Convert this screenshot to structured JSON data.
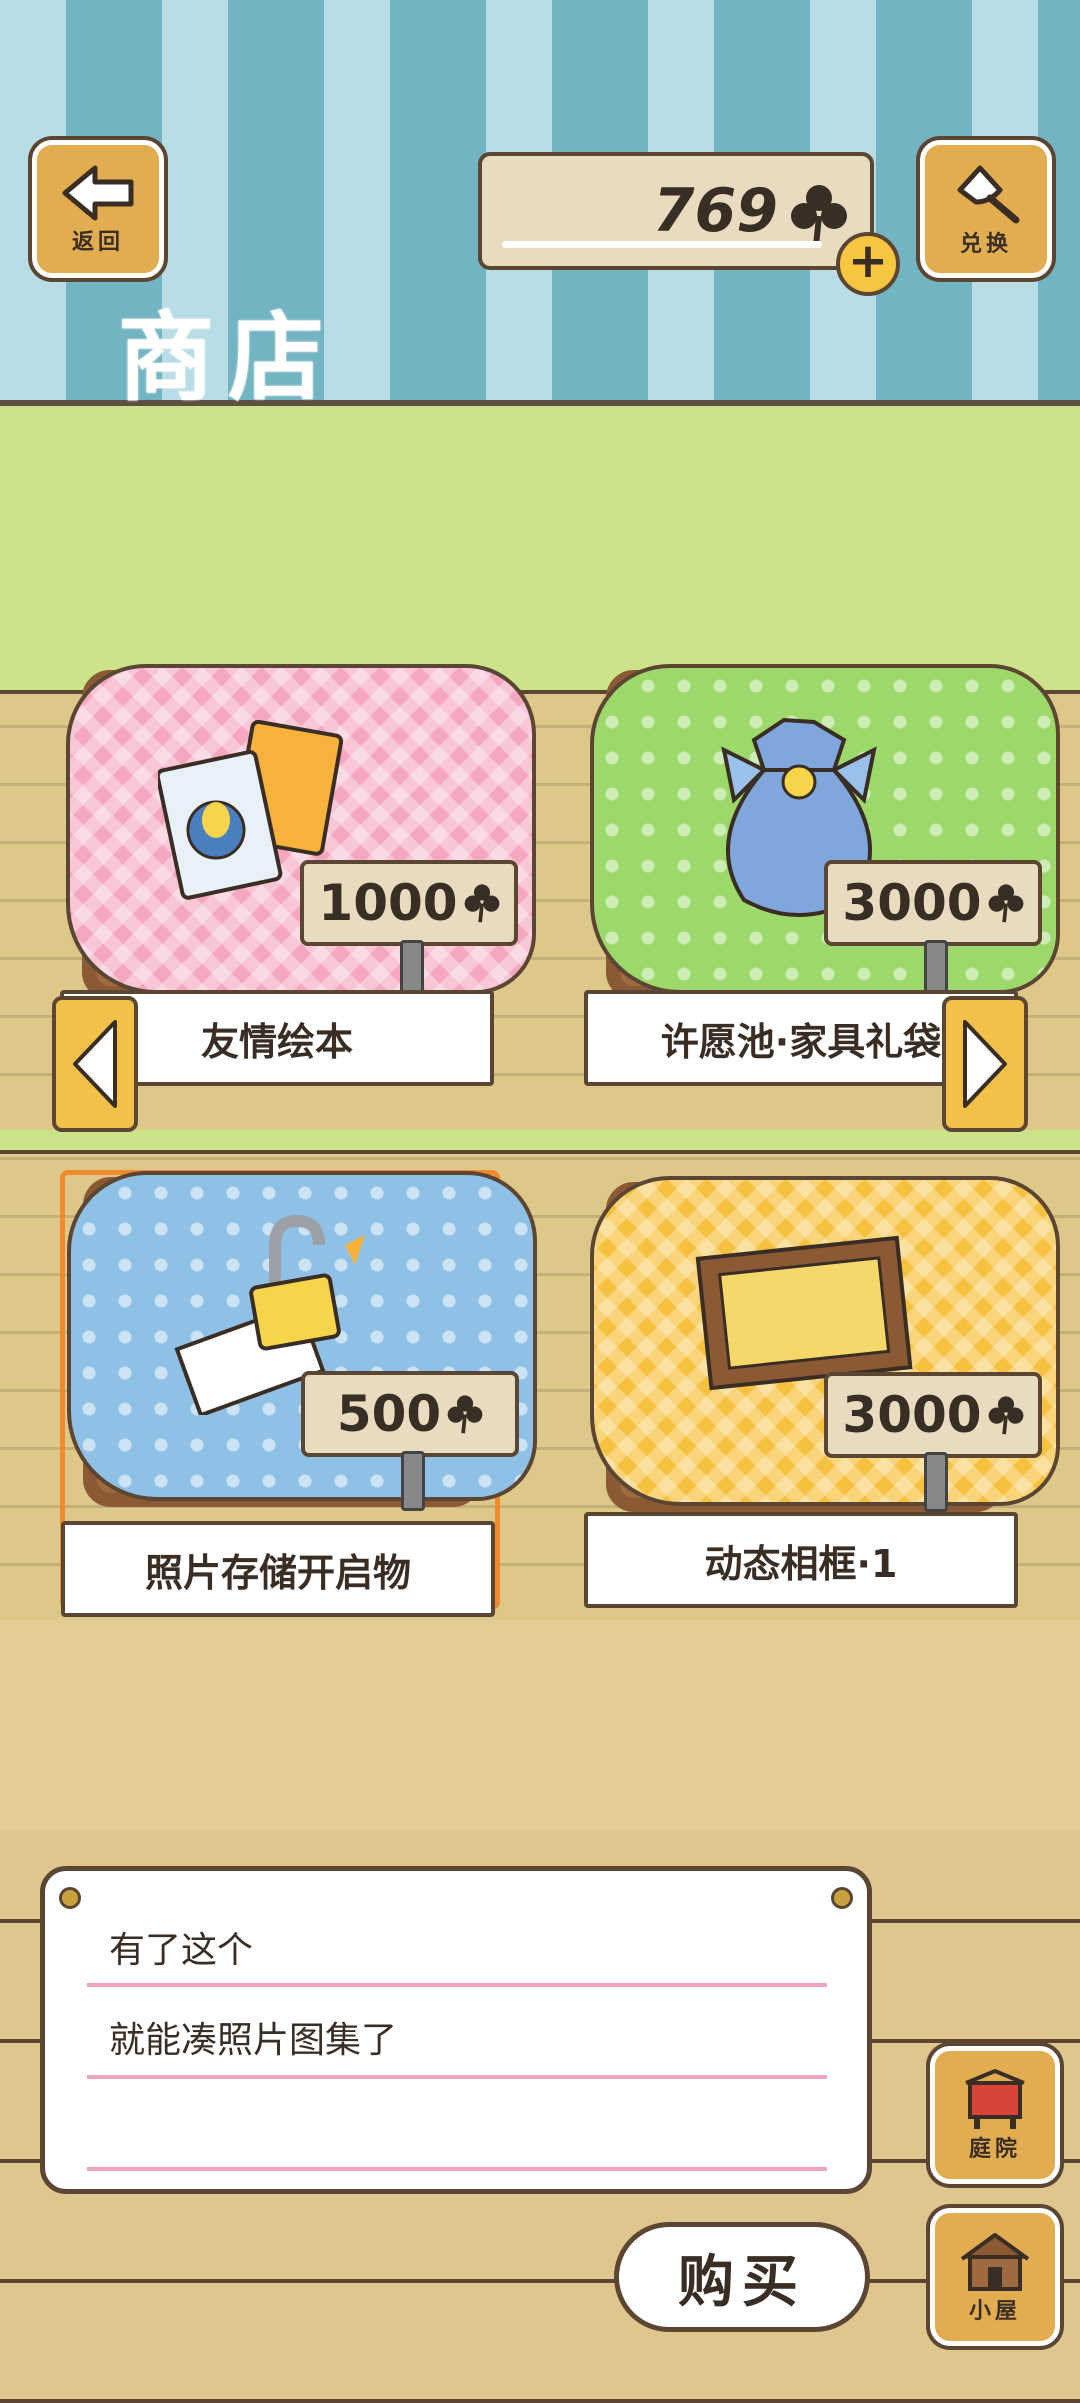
{
  "header": {
    "back_label": "返回",
    "exchange_label": "兑换",
    "title": "商店",
    "currency_value": "769",
    "add_symbol": "+"
  },
  "items": [
    {
      "name": "友情绘本",
      "price": "1000",
      "cloth_color": "#f4a7bf"
    },
    {
      "name": "许愿池·家具礼袋",
      "price": "3000",
      "cloth_color": "#9cd86a"
    },
    {
      "name": "照片存储开启物",
      "price": "500",
      "cloth_color": "#8fc0e6"
    },
    {
      "name": "动态相框·1",
      "price": "3000",
      "cloth_color": "#f7c140"
    }
  ],
  "dialog": {
    "line1": "有了这个",
    "line2": "就能凑照片图集了"
  },
  "buy_label": "购买",
  "side_nav": {
    "yard_label": "庭院",
    "house_label": "小屋"
  },
  "colors": {
    "accent_wood": "#e2ac50",
    "selection_border": "#f08a2c",
    "dialog_line": "#f0a5be"
  }
}
